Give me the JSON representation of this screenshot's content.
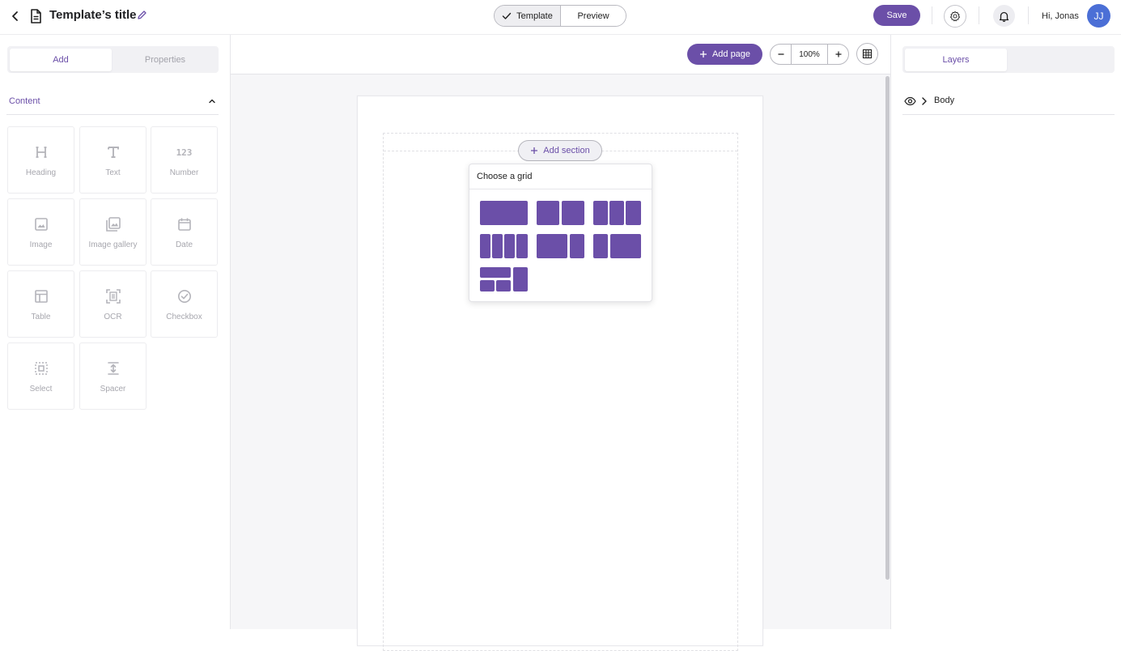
{
  "header": {
    "title": "Template’s title",
    "mode_toggle": {
      "template_label": "Template",
      "preview_label": "Preview",
      "selected": "Template"
    },
    "save_label": "Save",
    "greeting": "Hi, Jonas",
    "avatar_initials": "JJ"
  },
  "left_panel": {
    "tabs": {
      "add_label": "Add",
      "properties_label": "Properties",
      "active": "Add"
    },
    "content_section": {
      "label": "Content",
      "expanded": true,
      "items": [
        {
          "label": "Heading",
          "icon": "heading-icon"
        },
        {
          "label": "Text",
          "icon": "text-icon"
        },
        {
          "label": "Number",
          "icon": "number-icon",
          "glyph": "123"
        },
        {
          "label": "Image",
          "icon": "image-icon"
        },
        {
          "label": "Image gallery",
          "icon": "image-gallery-icon"
        },
        {
          "label": "Date",
          "icon": "calendar-icon"
        },
        {
          "label": "Table",
          "icon": "table-icon"
        },
        {
          "label": "OCR",
          "icon": "ocr-icon"
        },
        {
          "label": "Checkbox",
          "icon": "checkbox-icon"
        },
        {
          "label": "Select",
          "icon": "select-icon"
        },
        {
          "label": "Spacer",
          "icon": "spacer-icon"
        }
      ]
    }
  },
  "canvas": {
    "add_page_label": "Add page",
    "zoom_value": "100%",
    "add_section_label": "Add section",
    "grid_popup": {
      "title": "Choose a grid",
      "options": [
        "1 column",
        "2 columns",
        "3 columns",
        "4 columns",
        "2/3 + 1/3",
        "1/3 + 2/3",
        "split left + full right"
      ]
    }
  },
  "right_panel": {
    "tab_label": "Layers",
    "layers": [
      {
        "name": "Body",
        "visible": true,
        "expanded": false
      }
    ]
  },
  "colors": {
    "accent": "#6b4fa8",
    "avatar": "#4b6fd6",
    "muted_text": "#a7a7ae"
  }
}
